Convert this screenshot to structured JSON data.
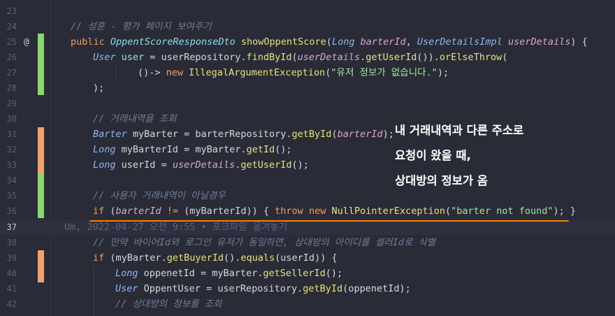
{
  "annotation": {
    "lines": [
      "내 거래내역과 다른 주소로",
      "요청이 왔을 때,",
      "상대방의 정보가 옴"
    ],
    "underline_color": "#ff7a00"
  },
  "blame": "Um, 2022-04-27 오전 9:55 • 포크파일 옮겨놓기",
  "line_numbers": [
    "23",
    "24",
    "25",
    "26",
    "27",
    "28",
    "29",
    "30",
    "31",
    "32",
    "33",
    "34",
    "35",
    "36",
    "37",
    "38",
    "39",
    "40",
    "41",
    "42"
  ],
  "current_line": "37",
  "gutter_icon": "@",
  "code": {
    "l24_comment": "// 성훈 - 평가 페이지 보여주기",
    "l25": {
      "public": "public",
      "ret": "OppentScoreResponseDto",
      "name": "showOppentScore",
      "p1t": "Long",
      "p1": "barterId",
      "p2t": "UserDetailsImpl",
      "p2": "userDetails",
      "end": ") {"
    },
    "l26": {
      "type": "User",
      "var": "user",
      "eq": " = ",
      "repo": "userRepository",
      "m1": "findById",
      "arg": "userDetails",
      "m2": "getUserId",
      "m3": "orElseThrow",
      "tail": "("
    },
    "l27": {
      "lambda": "()-> ",
      "new": "new",
      "exc": "IllegalArgumentException",
      "str": "\"유저 정보가 없습니다.\"",
      "end": ");"
    },
    "l28": ");",
    "l30_comment": "// 거래내역을 조회",
    "l31": {
      "type": "Barter",
      "var": "myBarter",
      "repo": "barterRepository",
      "m": "getById",
      "arg": "barterId",
      "end": ");"
    },
    "l32": {
      "type": "Long",
      "var": "myBarterId",
      "obj": "myBarter",
      "m": "getId",
      "end": "();"
    },
    "l33": {
      "type": "Long",
      "var": "userId",
      "obj": "userDetails",
      "m": "getUserId",
      "end": "();"
    },
    "l35_comment": "// 사용자 거래내역이 아닐경우",
    "l36": {
      "if": "if",
      "a": "barterId",
      "op": "!=",
      "b": "myBarterId",
      "throw": "throw",
      "new": "new",
      "exc": "NullPointerException",
      "str": "\"barter not found\""
    },
    "l38_comment": "// 만약 바이어Id와 로그인 유저가 동일하면, 상대방의 아이디를 셀러Id로 식별",
    "l39": {
      "if": "if",
      "obj": "myBarter",
      "m1": "getBuyerId",
      "m2": "equals",
      "arg": "userId"
    },
    "l40": {
      "type": "Long",
      "var": "oppenetId",
      "obj": "myBarter",
      "m": "getSellerId"
    },
    "l41": {
      "type": "User",
      "var": "OppentUser",
      "repo": "userRepository",
      "m": "getById",
      "arg": "oppenetId"
    },
    "l42_comment": "// 상대방의 정보를 조회"
  }
}
